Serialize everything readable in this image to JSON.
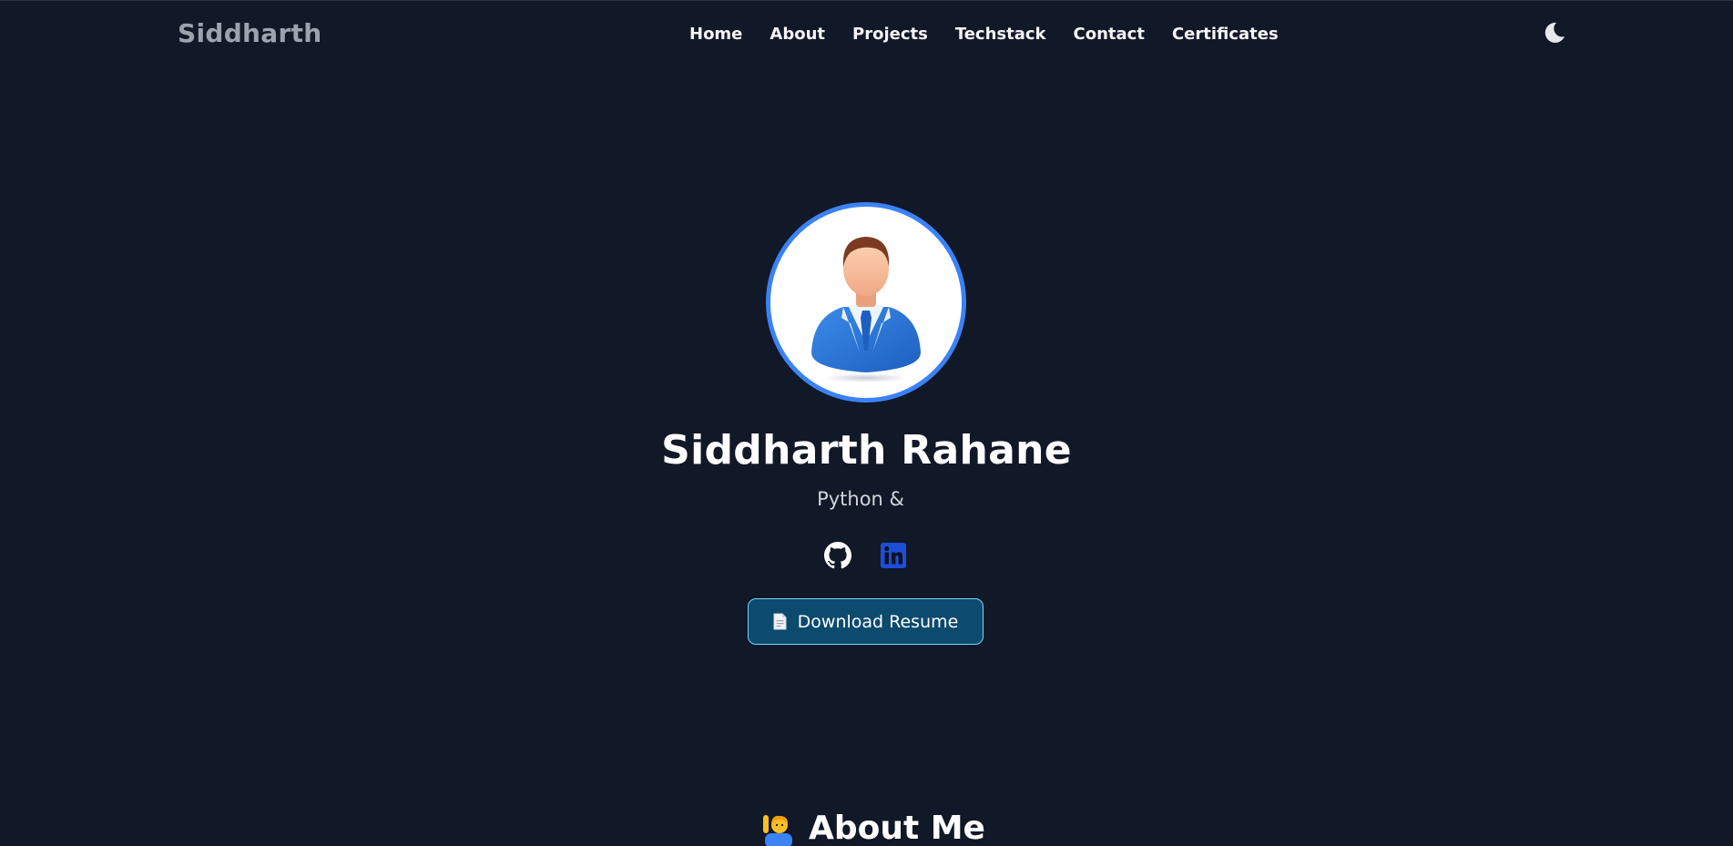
{
  "navbar": {
    "brand": "Siddharth",
    "links": [
      "Home",
      "About",
      "Projects",
      "Techstack",
      "Contact",
      "Certificates"
    ],
    "theme_icon": "moon-icon"
  },
  "hero": {
    "avatar_icon": "businessman-avatar",
    "name": "Siddharth Rahane",
    "role": "Python &",
    "socials": [
      {
        "icon": "github-icon"
      },
      {
        "icon": "linkedin-icon"
      }
    ],
    "resume_icon": "document-icon",
    "resume_label": "Download Resume"
  },
  "about": {
    "icon": "person-raising-hand-emoji",
    "title": "About Me"
  },
  "colors": {
    "background": "#111827",
    "accent": "#3b82f6",
    "button_bg": "#0c4a6e",
    "button_border": "#7dd3fc",
    "linkedin": "#1d4ed8"
  }
}
